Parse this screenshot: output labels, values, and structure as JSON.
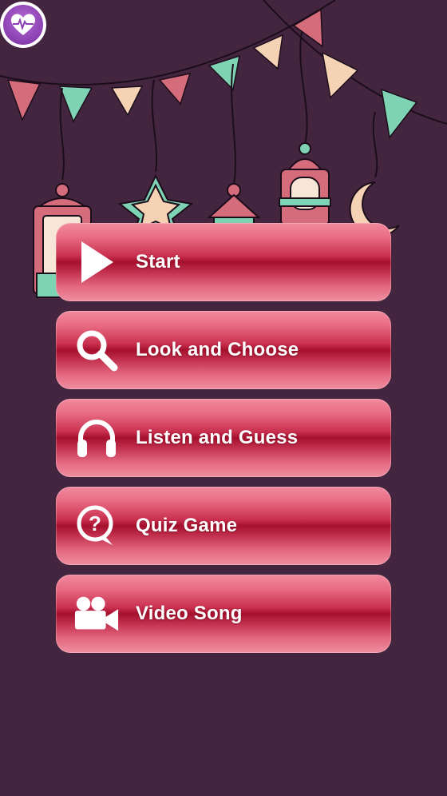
{
  "app": {
    "badge_icon": "heart-pulse-icon",
    "background_color": "#432540",
    "accent_color": "#c9304f"
  },
  "menu": {
    "items": [
      {
        "label": "Start",
        "icon": "play-icon"
      },
      {
        "label": "Look and Choose",
        "icon": "search-icon"
      },
      {
        "label": "Listen and Guess",
        "icon": "headphones-icon"
      },
      {
        "label": "Quiz Game",
        "icon": "question-bubble-icon"
      },
      {
        "label": "Video Song",
        "icon": "video-camera-icon"
      }
    ]
  }
}
